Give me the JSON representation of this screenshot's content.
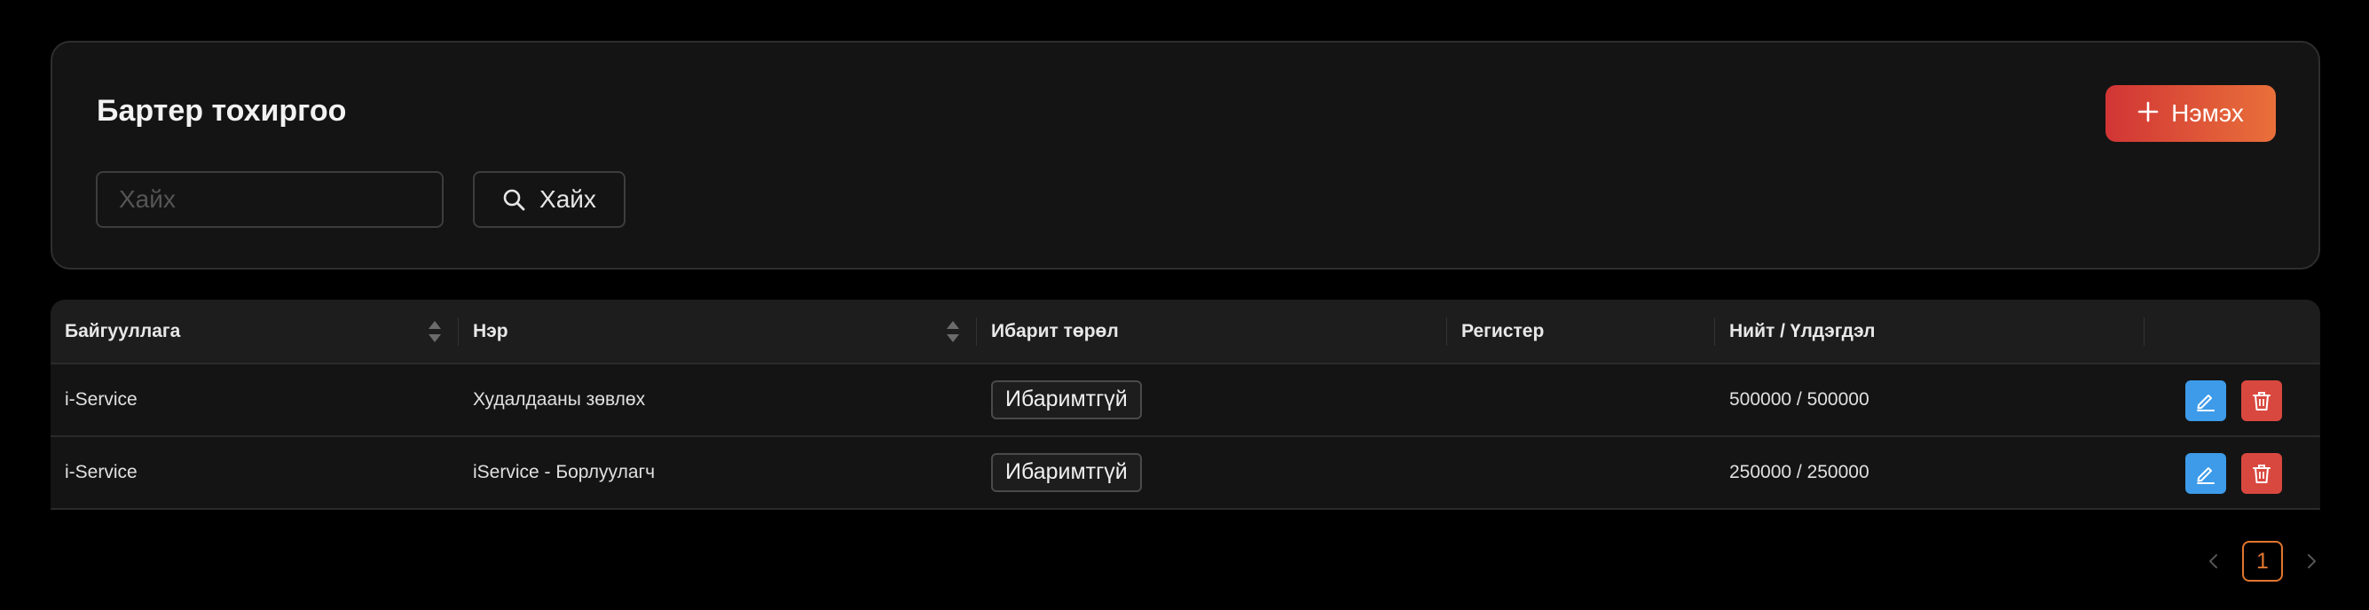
{
  "header": {
    "title": "Бартер тохиргоо",
    "add_label": "Нэмэх",
    "search_placeholder": "Хайх",
    "search_value": "",
    "search_button_label": "Хайх"
  },
  "table": {
    "columns": [
      {
        "label": "Байгууллага",
        "sortable": true
      },
      {
        "label": "Нэр",
        "sortable": true
      },
      {
        "label": "Ибарит төрөл",
        "sortable": false
      },
      {
        "label": "Регистер",
        "sortable": false
      },
      {
        "label": "Нийт / Үлдэгдэл",
        "sortable": false
      },
      {
        "label": "",
        "sortable": false
      }
    ],
    "rows": [
      {
        "organization": "i-Service",
        "name": "Худалдааны зөвлөх",
        "type": "Ибаримтгүй",
        "register": "",
        "total_balance": "500000 / 500000"
      },
      {
        "organization": "i-Service",
        "name": "iService - Борлуулагч",
        "type": "Ибаримтгүй",
        "register": "",
        "total_balance": "250000 / 250000"
      }
    ]
  },
  "pagination": {
    "current_page": "1",
    "prev_icon": "chevron-left-icon",
    "next_icon": "chevron-right-icon"
  },
  "colors": {
    "background": "#000000",
    "card": "#141414",
    "accent_gradient_start": "#d13535",
    "accent_gradient_end": "#e9703a",
    "edit": "#3d9be9",
    "delete": "#d9483f",
    "page_active": "#e0762f"
  }
}
